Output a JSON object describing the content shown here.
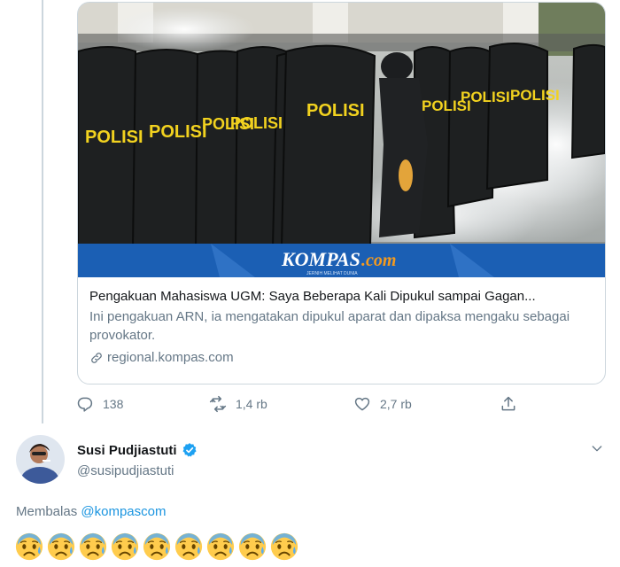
{
  "card": {
    "image_logo_main": "KOMPAS",
    "image_logo_suffix": ".com",
    "image_logo_tagline": "JERNIH MELIHAT DUNIA",
    "shield_text": "POLISI",
    "title": "Pengakuan Mahasiswa UGM: Saya Beberapa Kali Dipukul sampai Gagan...",
    "description": "Ini pengakuan ARN, ia mengatakan dipukul aparat dan dipaksa mengaku sebagai provokator.",
    "domain": "regional.kompas.com"
  },
  "actions": {
    "replies": "138",
    "retweets": "1,4 rb",
    "likes": "2,7 rb"
  },
  "reply_tweet": {
    "name": "Susi Pudjiastuti",
    "handle": "@susipudjiastuti",
    "replying_prefix": "Membalas",
    "replying_to": "@kompascom",
    "emoji_count": 9
  },
  "colors": {
    "accent": "#1b95e0",
    "muted": "#657786",
    "verified": "#1da1f2",
    "kompas_blue": "#1b5fb4"
  }
}
